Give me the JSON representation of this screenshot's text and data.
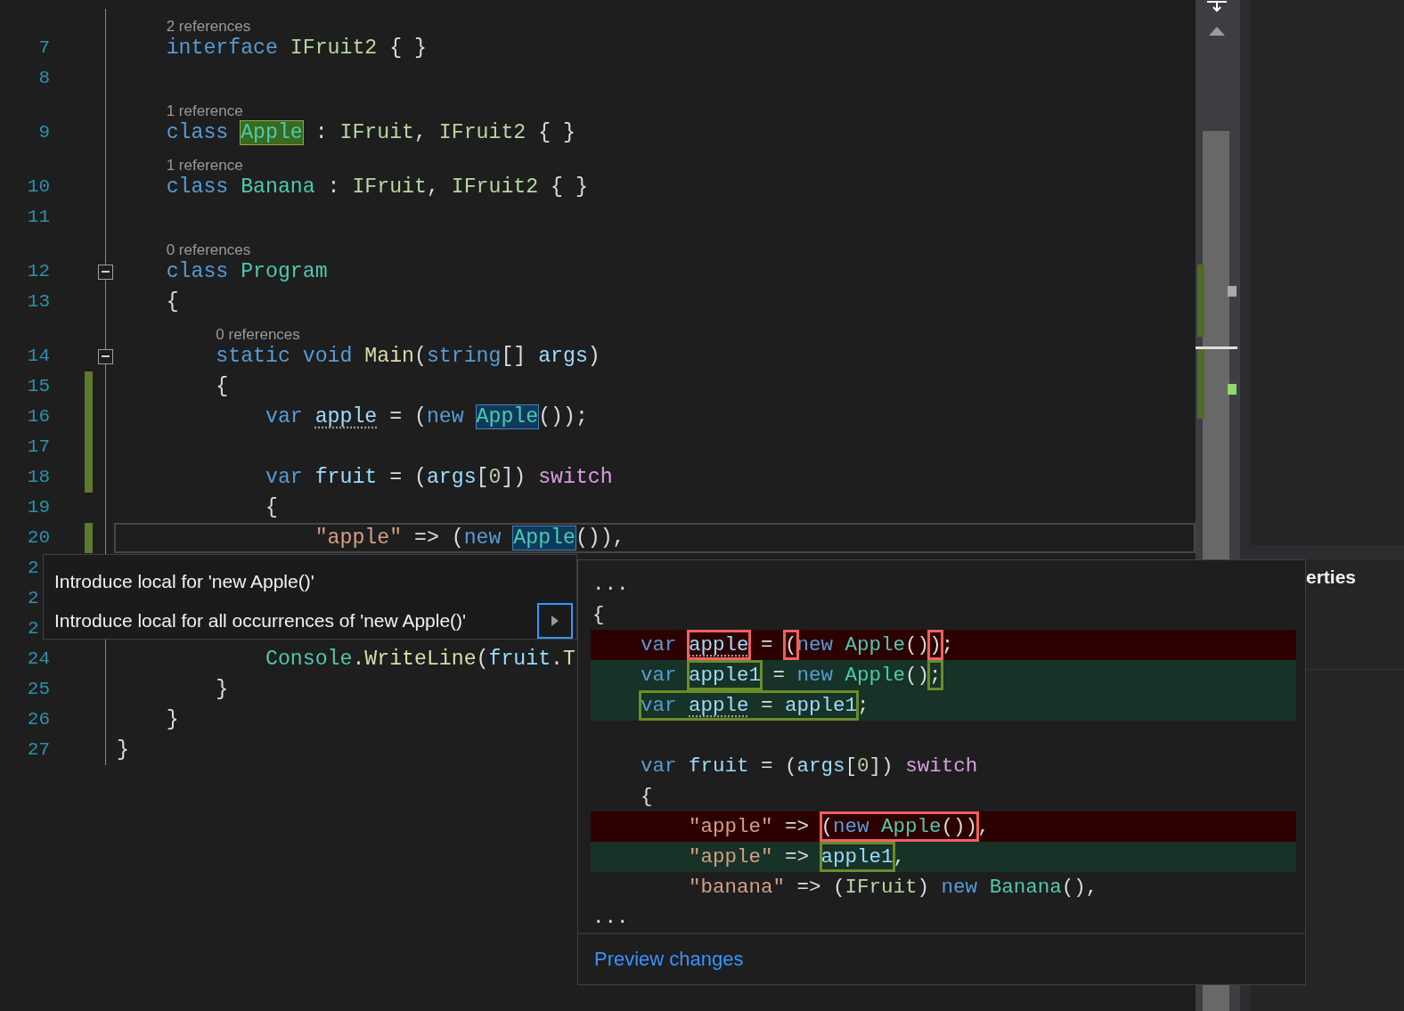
{
  "editor": {
    "lines": [
      {
        "number": "7",
        "cut": false,
        "lens": "2 references",
        "changed": false,
        "current": false,
        "foldable": false,
        "tokens": [
          {
            "text": "    interface",
            "kind": "kw"
          },
          {
            "text": " IFruit2",
            "kind": "iface"
          },
          {
            "text": " { }",
            "kind": "punc"
          }
        ]
      },
      {
        "number": "8",
        "cut": false,
        "changed": false,
        "current": false,
        "foldable": false
      },
      {
        "number": "9",
        "cut": false,
        "lens": "1 reference",
        "changed": false,
        "current": false,
        "foldable": false,
        "tokens": [
          {
            "text": "    class ",
            "kind": "kw"
          },
          {
            "text": "Apple",
            "kind": "definition"
          },
          {
            "text": " : ",
            "kind": "punc"
          },
          {
            "text": "IFruit",
            "kind": "iface"
          },
          {
            "text": ", ",
            "kind": "punc"
          },
          {
            "text": "IFruit2",
            "kind": "iface"
          },
          {
            "text": " { }",
            "kind": "punc"
          }
        ]
      },
      {
        "number": "10",
        "cut": false,
        "lens": "1 reference",
        "changed": false,
        "current": false,
        "foldable": false,
        "tokens": [
          {
            "text": "    class ",
            "kind": "kw"
          },
          {
            "text": "Banana",
            "kind": "type"
          },
          {
            "text": " : ",
            "kind": "punc"
          },
          {
            "text": "IFruit",
            "kind": "iface"
          },
          {
            "text": ", ",
            "kind": "punc"
          },
          {
            "text": "IFruit2",
            "kind": "iface"
          },
          {
            "text": " { }",
            "kind": "punc"
          }
        ]
      },
      {
        "number": "11",
        "cut": false,
        "changed": false,
        "current": false,
        "foldable": false
      },
      {
        "number": "12",
        "cut": false,
        "lens": "0 references",
        "changed": false,
        "current": false,
        "foldable": true,
        "tokens": [
          {
            "text": "    class ",
            "kind": "kw"
          },
          {
            "text": "Program",
            "kind": "type"
          }
        ]
      },
      {
        "number": "13",
        "cut": false,
        "changed": false,
        "current": false,
        "foldable": false,
        "tokens": [
          {
            "text": "    {",
            "kind": "punc"
          }
        ]
      },
      {
        "number": "14",
        "cut": false,
        "lens": "0 references",
        "changed": false,
        "current": false,
        "foldable": true,
        "tokens": [
          {
            "text": "        static void ",
            "kind": "kw"
          },
          {
            "text": "Main",
            "kind": "method"
          },
          {
            "text": "(",
            "kind": "punc"
          },
          {
            "text": "string",
            "kind": "kw"
          },
          {
            "text": "[] ",
            "kind": "punc"
          },
          {
            "text": "args",
            "kind": "local"
          },
          {
            "text": ")",
            "kind": "punc"
          }
        ]
      },
      {
        "number": "15",
        "cut": false,
        "changed": true,
        "current": false,
        "foldable": false,
        "tokens": [
          {
            "text": "        {",
            "kind": "punc"
          }
        ]
      },
      {
        "number": "16",
        "cut": false,
        "changed": true,
        "current": false,
        "foldable": false,
        "tokens": [
          {
            "text": "            var ",
            "kind": "kw"
          },
          {
            "text": "apple",
            "kind": "hinted"
          },
          {
            "text": " = (",
            "kind": "punc"
          },
          {
            "text": "new ",
            "kind": "kw"
          },
          {
            "text": "Apple",
            "kind": "reference"
          },
          {
            "text": "());",
            "kind": "punc"
          }
        ]
      },
      {
        "number": "17",
        "cut": false,
        "changed": true,
        "current": false,
        "foldable": false
      },
      {
        "number": "18",
        "cut": false,
        "changed": true,
        "current": false,
        "foldable": false,
        "tokens": [
          {
            "text": "            var ",
            "kind": "kw"
          },
          {
            "text": "fruit",
            "kind": "local"
          },
          {
            "text": " = (",
            "kind": "punc"
          },
          {
            "text": "args",
            "kind": "local"
          },
          {
            "text": "[",
            "kind": "punc"
          },
          {
            "text": "0",
            "kind": "num"
          },
          {
            "text": "]) ",
            "kind": "punc"
          },
          {
            "text": "switch",
            "kind": "ctrl"
          }
        ]
      },
      {
        "number": "19",
        "cut": false,
        "changed": false,
        "current": false,
        "foldable": false,
        "tokens": [
          {
            "text": "            {",
            "kind": "punc"
          }
        ]
      },
      {
        "number": "20",
        "cut": false,
        "changed": true,
        "current": true,
        "foldable": false,
        "tokens": [
          {
            "text": "                \"apple\"",
            "kind": "str"
          },
          {
            "text": " => (",
            "kind": "punc"
          },
          {
            "text": "new ",
            "kind": "kw"
          },
          {
            "text": "Apple",
            "kind": "reference"
          },
          {
            "text": "()),",
            "kind": "punc"
          }
        ]
      },
      {
        "number": "2",
        "cut": true,
        "changed": false,
        "current": false,
        "foldable": false
      },
      {
        "number": "2",
        "cut": true,
        "changed": false,
        "current": false,
        "foldable": false
      },
      {
        "number": "2",
        "cut": true,
        "changed": false,
        "current": false,
        "foldable": false
      },
      {
        "number": "24",
        "cut": false,
        "changed": false,
        "current": false,
        "foldable": false,
        "tokens": [
          {
            "text": "            Console",
            "kind": "type"
          },
          {
            "text": ".",
            "kind": "punc"
          },
          {
            "text": "WriteLine",
            "kind": "method"
          },
          {
            "text": "(",
            "kind": "punc"
          },
          {
            "text": "fruit",
            "kind": "local"
          },
          {
            "text": ".",
            "kind": "punc"
          },
          {
            "text": "T",
            "kind": "method"
          }
        ]
      },
      {
        "number": "25",
        "cut": false,
        "changed": false,
        "current": false,
        "foldable": false,
        "tokens": [
          {
            "text": "        }",
            "kind": "punc"
          }
        ]
      },
      {
        "number": "26",
        "cut": false,
        "changed": false,
        "current": false,
        "foldable": false,
        "tokens": [
          {
            "text": "    }",
            "kind": "punc"
          }
        ]
      },
      {
        "number": "27",
        "cut": false,
        "changed": false,
        "current": false,
        "foldable": false,
        "tokens": [
          {
            "text": "}",
            "kind": "punc"
          }
        ]
      }
    ]
  },
  "side_panel": {
    "title": "erties"
  },
  "quick_actions": {
    "items": [
      {
        "label": "Introduce local for 'new Apple()'",
        "selected": false
      },
      {
        "label": "Introduce local for all occurrences of 'new Apple()'",
        "selected": true
      }
    ]
  },
  "preview": {
    "lines": [
      {
        "kind": "normal",
        "tokens": [
          {
            "text": "...",
            "kind": "punc"
          }
        ]
      },
      {
        "kind": "normal",
        "tokens": [
          {
            "text": "{",
            "kind": "punc"
          }
        ]
      },
      {
        "kind": "removed",
        "tokens": [
          {
            "text": "    var ",
            "kind": "kw"
          },
          {
            "kind": "removed_box",
            "tokens": [
              {
                "text": "apple",
                "kind": "hinted"
              }
            ]
          },
          {
            "text": " = ",
            "kind": "punc"
          },
          {
            "kind": "removed_box",
            "tokens": [
              {
                "text": "(",
                "kind": "punc"
              }
            ]
          },
          {
            "text": "new ",
            "kind": "kw"
          },
          {
            "text": "Apple",
            "kind": "type"
          },
          {
            "text": "()",
            "kind": "punc"
          },
          {
            "kind": "removed_box",
            "tokens": [
              {
                "text": ")",
                "kind": "punc"
              }
            ]
          },
          {
            "text": ";",
            "kind": "punc"
          }
        ]
      },
      {
        "kind": "added",
        "tokens": [
          {
            "text": "    var ",
            "kind": "kw"
          },
          {
            "kind": "added_box",
            "tokens": [
              {
                "text": "apple1",
                "kind": "local"
              }
            ]
          },
          {
            "text": " = ",
            "kind": "punc"
          },
          {
            "text": "new ",
            "kind": "kw"
          },
          {
            "text": "Apple",
            "kind": "type"
          },
          {
            "text": "()",
            "kind": "punc"
          },
          {
            "kind": "added_box",
            "tokens": [
              {
                "text": ";",
                "kind": "punc"
              }
            ]
          }
        ]
      },
      {
        "kind": "added",
        "tokens": [
          {
            "kind": "added_box",
            "tokens": [
              {
                "text": "    var ",
                "kind": "kw"
              },
              {
                "text": "apple",
                "kind": "hinted"
              },
              {
                "text": " = ",
                "kind": "punc"
              },
              {
                "text": "apple1",
                "kind": "local"
              }
            ]
          },
          {
            "text": ";",
            "kind": "punc"
          }
        ]
      },
      {
        "kind": "normal"
      },
      {
        "kind": "normal",
        "tokens": [
          {
            "text": "    var ",
            "kind": "kw"
          },
          {
            "text": "fruit",
            "kind": "local"
          },
          {
            "text": " = (",
            "kind": "punc"
          },
          {
            "text": "args",
            "kind": "local"
          },
          {
            "text": "[",
            "kind": "punc"
          },
          {
            "text": "0",
            "kind": "num"
          },
          {
            "text": "]) ",
            "kind": "punc"
          },
          {
            "text": "switch",
            "kind": "ctrl"
          }
        ]
      },
      {
        "kind": "normal",
        "tokens": [
          {
            "text": "    {",
            "kind": "punc"
          }
        ]
      },
      {
        "kind": "removed",
        "tokens": [
          {
            "text": "        \"apple\"",
            "kind": "str"
          },
          {
            "text": " => ",
            "kind": "punc"
          },
          {
            "kind": "removed_box",
            "tokens": [
              {
                "text": "(",
                "kind": "punc"
              },
              {
                "text": "new ",
                "kind": "kw"
              },
              {
                "text": "Apple",
                "kind": "type"
              },
              {
                "text": "())",
                "kind": "punc"
              }
            ]
          },
          {
            "text": ",",
            "kind": "punc"
          }
        ]
      },
      {
        "kind": "added",
        "tokens": [
          {
            "text": "        \"apple\"",
            "kind": "str"
          },
          {
            "text": " => ",
            "kind": "punc"
          },
          {
            "kind": "added_box",
            "tokens": [
              {
                "text": "apple1",
                "kind": "local"
              }
            ]
          },
          {
            "text": ",",
            "kind": "punc"
          }
        ]
      },
      {
        "kind": "normal",
        "tokens": [
          {
            "text": "        \"banana\"",
            "kind": "str"
          },
          {
            "text": " => (",
            "kind": "punc"
          },
          {
            "text": "IFruit",
            "kind": "iface"
          },
          {
            "text": ") ",
            "kind": "punc"
          },
          {
            "text": "new ",
            "kind": "kw"
          },
          {
            "text": "Banana",
            "kind": "type"
          },
          {
            "text": "(),",
            "kind": "punc"
          }
        ]
      },
      {
        "kind": "normal",
        "tokens": [
          {
            "text": "...",
            "kind": "punc"
          }
        ]
      }
    ],
    "link": "Preview changes"
  }
}
